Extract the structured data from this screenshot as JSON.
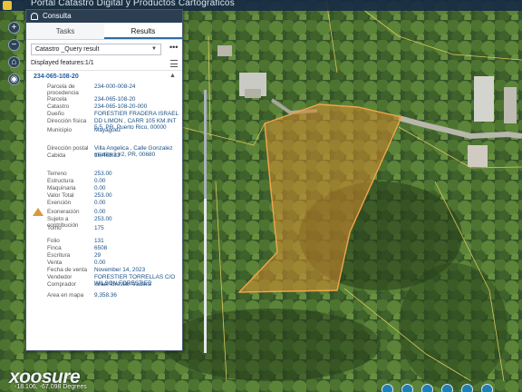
{
  "app": {
    "title": "Portal Catastro Digital y Productos Cartográficos"
  },
  "map_tools": [
    "zoom-in",
    "zoom-out",
    "home",
    "locate"
  ],
  "panel": {
    "title": "Consulta",
    "tabs": [
      {
        "label": "Tasks",
        "active": false
      },
      {
        "label": "Results",
        "active": true
      }
    ],
    "dropdown_value": "Catastro _Query result",
    "more_label": "•••",
    "features_label": "Displayed features:1/1",
    "result_id": "234-065-108-20",
    "fields": [
      {
        "key": "Parcela de procedencia",
        "value": "234-000-008-24"
      },
      {
        "key": "Parcela",
        "value": "234-065-108-20"
      },
      {
        "key": "Catastro",
        "value": "234-065-108-20-000"
      },
      {
        "key": "Dueño",
        "value": "FORESTIER FRADERA ISRAEL"
      },
      {
        "key": "Dirección física",
        "value": "DD LIMON , CARR 105 KM.INT 5.5, PR, Puerto Rico, 00000"
      },
      {
        "key": "Municipio",
        "value": "Mayagüez"
      },
      {
        "key": "Dirección postal",
        "value": "Villa Angelica , Calle Gonzalez martinez #2, PR, 00680"
      },
      {
        "key": "Cabida",
        "value": "16,468.33"
      },
      {
        "key": "Terreno",
        "value": "253.00"
      },
      {
        "key": "Estructura",
        "value": "0.00"
      },
      {
        "key": "Maquinaria",
        "value": "0.00"
      },
      {
        "key": "Valor Total",
        "value": "253.00"
      },
      {
        "key": "Exención",
        "value": "0.00"
      },
      {
        "key": "Exoneración",
        "value": "0.00"
      },
      {
        "key": "Sujeto a contribución",
        "value": "253.00"
      },
      {
        "key": "Tomo",
        "value": "175"
      },
      {
        "key": "Folio",
        "value": "131"
      },
      {
        "key": "Finca",
        "value": "6508"
      },
      {
        "key": "Escritura",
        "value": "29"
      },
      {
        "key": "Venta",
        "value": "0.00"
      },
      {
        "key": "Fecha de venta",
        "value": "November 14, 2023"
      },
      {
        "key": "Vendedor",
        "value": "FORESTIER TORRELLAS C/O WILSON FORESTIER"
      },
      {
        "key": "Comprador",
        "value": "Israel forestier fradera"
      },
      {
        "key": "Area en mapa",
        "value": "9,358.36"
      }
    ]
  },
  "logo": {
    "text": "xoosure"
  },
  "status": {
    "coordinates": "-18.106, -67.098 Degrees"
  },
  "colors": {
    "parcel_fill": "#d58a2e",
    "parcel_stroke": "#f0a64a",
    "panel_header": "#2c3f52",
    "link": "#1b4f86"
  }
}
